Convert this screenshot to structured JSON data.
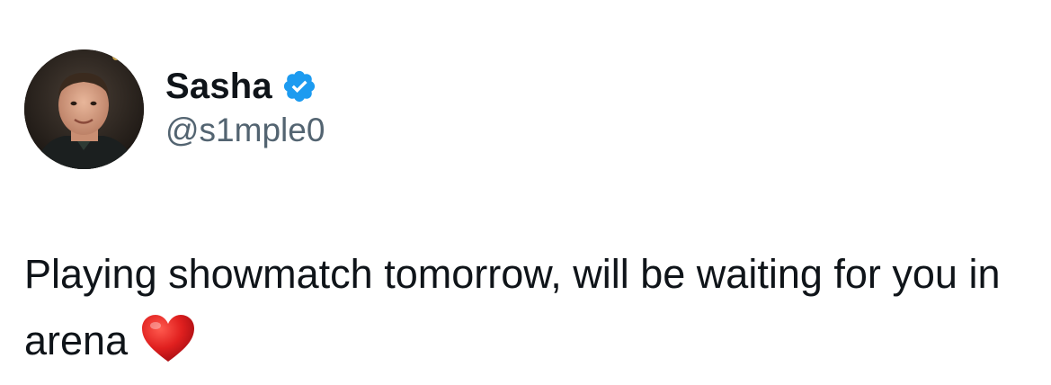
{
  "tweet": {
    "author": {
      "display_name": "Sasha",
      "handle": "@s1mple0",
      "verified": true,
      "verified_color": "#1d9bf0"
    },
    "text": "Playing showmatch tomorrow, will be waiting for you in arena",
    "emoji": "red-heart"
  },
  "colors": {
    "text_primary": "#0f1419",
    "text_secondary": "#536471",
    "background": "#ffffff",
    "heart": "#e0201f"
  }
}
